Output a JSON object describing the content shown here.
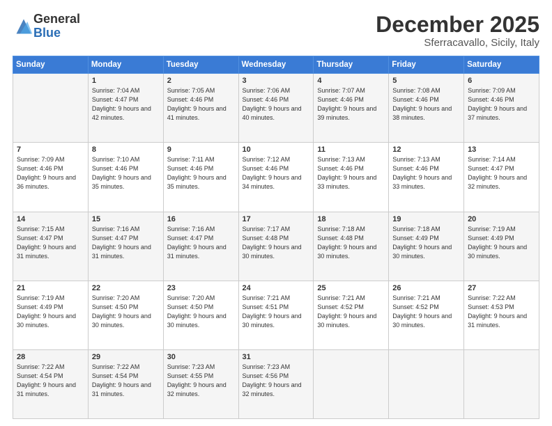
{
  "logo": {
    "general": "General",
    "blue": "Blue"
  },
  "header": {
    "month": "December 2025",
    "location": "Sferracavallo, Sicily, Italy"
  },
  "weekdays": [
    "Sunday",
    "Monday",
    "Tuesday",
    "Wednesday",
    "Thursday",
    "Friday",
    "Saturday"
  ],
  "weeks": [
    [
      {
        "day": null
      },
      {
        "day": 1,
        "sunrise": "7:04 AM",
        "sunset": "4:47 PM",
        "daylight": "9 hours and 42 minutes."
      },
      {
        "day": 2,
        "sunrise": "7:05 AM",
        "sunset": "4:46 PM",
        "daylight": "9 hours and 41 minutes."
      },
      {
        "day": 3,
        "sunrise": "7:06 AM",
        "sunset": "4:46 PM",
        "daylight": "9 hours and 40 minutes."
      },
      {
        "day": 4,
        "sunrise": "7:07 AM",
        "sunset": "4:46 PM",
        "daylight": "9 hours and 39 minutes."
      },
      {
        "day": 5,
        "sunrise": "7:08 AM",
        "sunset": "4:46 PM",
        "daylight": "9 hours and 38 minutes."
      },
      {
        "day": 6,
        "sunrise": "7:09 AM",
        "sunset": "4:46 PM",
        "daylight": "9 hours and 37 minutes."
      }
    ],
    [
      {
        "day": 7,
        "sunrise": "7:09 AM",
        "sunset": "4:46 PM",
        "daylight": "9 hours and 36 minutes."
      },
      {
        "day": 8,
        "sunrise": "7:10 AM",
        "sunset": "4:46 PM",
        "daylight": "9 hours and 35 minutes."
      },
      {
        "day": 9,
        "sunrise": "7:11 AM",
        "sunset": "4:46 PM",
        "daylight": "9 hours and 35 minutes."
      },
      {
        "day": 10,
        "sunrise": "7:12 AM",
        "sunset": "4:46 PM",
        "daylight": "9 hours and 34 minutes."
      },
      {
        "day": 11,
        "sunrise": "7:13 AM",
        "sunset": "4:46 PM",
        "daylight": "9 hours and 33 minutes."
      },
      {
        "day": 12,
        "sunrise": "7:13 AM",
        "sunset": "4:46 PM",
        "daylight": "9 hours and 33 minutes."
      },
      {
        "day": 13,
        "sunrise": "7:14 AM",
        "sunset": "4:47 PM",
        "daylight": "9 hours and 32 minutes."
      }
    ],
    [
      {
        "day": 14,
        "sunrise": "7:15 AM",
        "sunset": "4:47 PM",
        "daylight": "9 hours and 31 minutes."
      },
      {
        "day": 15,
        "sunrise": "7:16 AM",
        "sunset": "4:47 PM",
        "daylight": "9 hours and 31 minutes."
      },
      {
        "day": 16,
        "sunrise": "7:16 AM",
        "sunset": "4:47 PM",
        "daylight": "9 hours and 31 minutes."
      },
      {
        "day": 17,
        "sunrise": "7:17 AM",
        "sunset": "4:48 PM",
        "daylight": "9 hours and 30 minutes."
      },
      {
        "day": 18,
        "sunrise": "7:18 AM",
        "sunset": "4:48 PM",
        "daylight": "9 hours and 30 minutes."
      },
      {
        "day": 19,
        "sunrise": "7:18 AM",
        "sunset": "4:49 PM",
        "daylight": "9 hours and 30 minutes."
      },
      {
        "day": 20,
        "sunrise": "7:19 AM",
        "sunset": "4:49 PM",
        "daylight": "9 hours and 30 minutes."
      }
    ],
    [
      {
        "day": 21,
        "sunrise": "7:19 AM",
        "sunset": "4:49 PM",
        "daylight": "9 hours and 30 minutes."
      },
      {
        "day": 22,
        "sunrise": "7:20 AM",
        "sunset": "4:50 PM",
        "daylight": "9 hours and 30 minutes."
      },
      {
        "day": 23,
        "sunrise": "7:20 AM",
        "sunset": "4:50 PM",
        "daylight": "9 hours and 30 minutes."
      },
      {
        "day": 24,
        "sunrise": "7:21 AM",
        "sunset": "4:51 PM",
        "daylight": "9 hours and 30 minutes."
      },
      {
        "day": 25,
        "sunrise": "7:21 AM",
        "sunset": "4:52 PM",
        "daylight": "9 hours and 30 minutes."
      },
      {
        "day": 26,
        "sunrise": "7:21 AM",
        "sunset": "4:52 PM",
        "daylight": "9 hours and 30 minutes."
      },
      {
        "day": 27,
        "sunrise": "7:22 AM",
        "sunset": "4:53 PM",
        "daylight": "9 hours and 31 minutes."
      }
    ],
    [
      {
        "day": 28,
        "sunrise": "7:22 AM",
        "sunset": "4:54 PM",
        "daylight": "9 hours and 31 minutes."
      },
      {
        "day": 29,
        "sunrise": "7:22 AM",
        "sunset": "4:54 PM",
        "daylight": "9 hours and 31 minutes."
      },
      {
        "day": 30,
        "sunrise": "7:23 AM",
        "sunset": "4:55 PM",
        "daylight": "9 hours and 32 minutes."
      },
      {
        "day": 31,
        "sunrise": "7:23 AM",
        "sunset": "4:56 PM",
        "daylight": "9 hours and 32 minutes."
      },
      {
        "day": null
      },
      {
        "day": null
      },
      {
        "day": null
      }
    ]
  ],
  "labels": {
    "sunrise": "Sunrise:",
    "sunset": "Sunset:",
    "daylight": "Daylight:"
  }
}
